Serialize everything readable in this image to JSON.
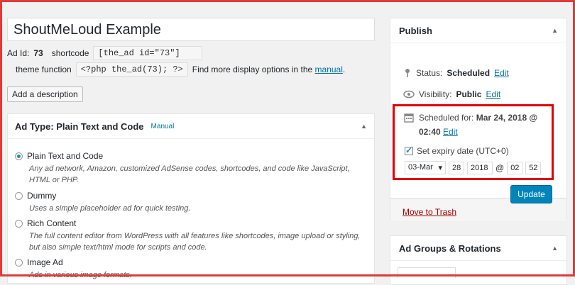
{
  "ad": {
    "title_value": "ShoutMeLoud Example",
    "id_label": "Ad Id:",
    "id_value": "73",
    "shortcode_label": "shortcode",
    "shortcode_value": "[the_ad id=\"73\"]",
    "theme_function_label": "theme function",
    "theme_function_value": "<?php the_ad(73); ?>",
    "more_options_text": "Find more display options in the",
    "manual_link": "manual",
    "manual_period": ".",
    "add_description_button": "Add a description"
  },
  "ad_type": {
    "heading": "Ad Type: Plain Text and Code",
    "manual_link": "Manual",
    "options": [
      {
        "label": "Plain Text and Code",
        "desc": "Any ad network, Amazon, customized AdSense codes, shortcodes, and code like JavaScript, HTML or PHP.",
        "checked": true
      },
      {
        "label": "Dummy",
        "desc": "Uses a simple placeholder ad for quick testing.",
        "checked": false
      },
      {
        "label": "Rich Content",
        "desc": "The full content editor from WordPress with all features like shortcodes, image upload or styling, but also simple text/html mode for scripts and code.",
        "checked": false
      },
      {
        "label": "Image Ad",
        "desc": "Ads in various image formats.",
        "checked": false
      }
    ]
  },
  "publish": {
    "heading": "Publish",
    "status_label": "Status:",
    "status_value": "Scheduled",
    "status_edit": "Edit",
    "visibility_label": "Visibility:",
    "visibility_value": "Public",
    "visibility_edit": "Edit",
    "scheduled_label": "Scheduled for:",
    "scheduled_value": "Mar 24, 2018 @ 02:40",
    "scheduled_edit": "Edit",
    "expiry_label": "Set expiry date (UTC+0)",
    "expiry_month": "03-Mar",
    "expiry_day": "28",
    "expiry_year": "2018",
    "at_sign": "@",
    "expiry_hour": "02",
    "expiry_minute": "52",
    "trash_link": "Move to Trash",
    "update_button": "Update"
  },
  "groups": {
    "heading": "Ad Groups & Rotations"
  },
  "icons": {
    "pin": "pin-icon",
    "eye": "eye-icon",
    "calendar": "calendar-icon",
    "collapse": "triangle-up-icon"
  },
  "colors": {
    "accent": "#0073aa",
    "button": "#0085ba",
    "highlight": "#e00000",
    "trash": "#a00000"
  }
}
